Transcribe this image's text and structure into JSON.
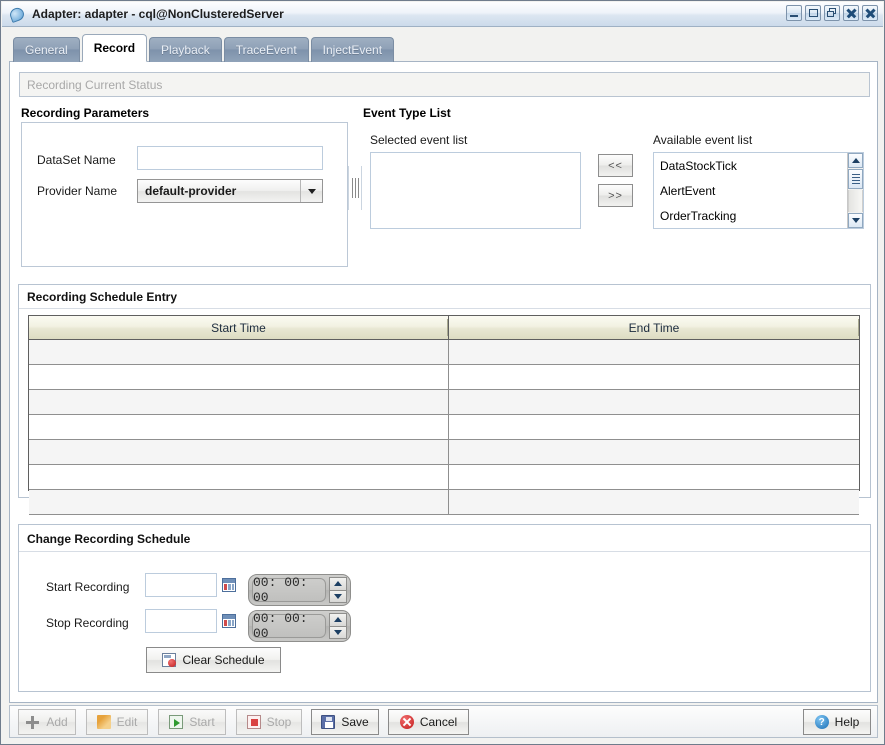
{
  "window": {
    "title": "Adapter: adapter - cql@NonClusteredServer",
    "icon": "adapter-icon",
    "controls": [
      {
        "name": "minimize-button",
        "glyph": "minimize"
      },
      {
        "name": "maximize-button",
        "glyph": "maximize"
      },
      {
        "name": "restore-button",
        "glyph": "restore"
      },
      {
        "name": "close-button",
        "glyph": "close"
      },
      {
        "name": "close-all-button",
        "glyph": "close"
      }
    ]
  },
  "tabs": [
    {
      "label": "General",
      "active": false
    },
    {
      "label": "Record",
      "active": true
    },
    {
      "label": "Playback",
      "active": false
    },
    {
      "label": "TraceEvent",
      "active": false
    },
    {
      "label": "InjectEvent",
      "active": false
    }
  ],
  "status": {
    "label": "Recording Current Status",
    "value": ""
  },
  "recording_parameters": {
    "heading": "Recording Parameters",
    "dataset_name_label": "DataSet Name",
    "dataset_name_value": "",
    "provider_name_label": "Provider Name",
    "provider_name_value": "default-provider"
  },
  "event_type_list": {
    "heading": "Event Type List",
    "selected_label": "Selected event list",
    "selected_items": [],
    "available_label": "Available event list",
    "available_items": [
      "DataStockTick",
      "AlertEvent",
      "OrderTracking"
    ],
    "move_left_label": "<<",
    "move_right_label": ">>"
  },
  "schedule": {
    "title": "Recording Schedule Entry",
    "columns": [
      "Start Time",
      "End Time"
    ],
    "rows": [
      [
        "",
        ""
      ],
      [
        "",
        ""
      ],
      [
        "",
        ""
      ],
      [
        "",
        ""
      ],
      [
        "",
        ""
      ],
      [
        "",
        ""
      ],
      [
        "",
        ""
      ]
    ]
  },
  "change_schedule": {
    "title": "Change Recording Schedule",
    "start_label": "Start Recording",
    "start_date_value": "",
    "start_time_value": "00: 00: 00",
    "stop_label": "Stop Recording",
    "stop_date_value": "",
    "stop_time_value": "00: 00: 00",
    "clear_button_label": "Clear Schedule"
  },
  "toolbar": {
    "buttons": [
      {
        "label": "Add",
        "icon": "plus-icon",
        "disabled": true
      },
      {
        "label": "Edit",
        "icon": "pencil-icon",
        "disabled": true
      },
      {
        "label": "Start",
        "icon": "play-icon",
        "disabled": true
      },
      {
        "label": "Stop",
        "icon": "stop-icon",
        "disabled": true
      },
      {
        "label": "Save",
        "icon": "floppy-disk-icon",
        "disabled": false
      },
      {
        "label": "Cancel",
        "icon": "cancel-icon",
        "disabled": false
      }
    ],
    "help_label": "Help",
    "help_icon": "question-mark-icon"
  },
  "colors": {
    "titlebar_accent": "#ccdbeb",
    "tab_inactive": "#8fa1b7",
    "table_header": "#e8e7d3",
    "row_alt": "#f5f5f5"
  }
}
